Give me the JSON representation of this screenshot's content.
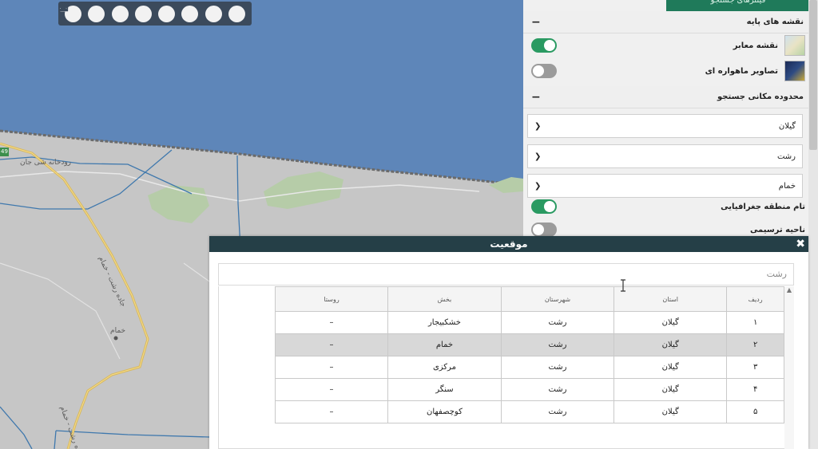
{
  "toolbar": {
    "tools": [
      {
        "name": "print-icon"
      },
      {
        "name": "zoom-in-icon"
      },
      {
        "name": "zoom-out-icon"
      },
      {
        "name": "measure-line-icon"
      },
      {
        "name": "measure-area-icon"
      },
      {
        "name": "info-icon"
      },
      {
        "name": "full-extent-icon"
      },
      {
        "name": "clear-brush-icon"
      }
    ]
  },
  "map": {
    "labels": {
      "river": "رودخانه شی جان",
      "village": "خمام",
      "road1": "جاده رشت - خمام",
      "road2": "جاده رشت - خمام"
    },
    "road_badge": "49",
    "colors": {
      "sea": "#5e86b9",
      "land": "#c6c6c6",
      "green": "#b6cca8",
      "road": "#d9b85b",
      "river": "#3f78ad"
    }
  },
  "panel": {
    "top_tab": "فیلترهای جستجو",
    "base_maps": {
      "title": "نقشه های پایه",
      "collapse": "−",
      "layers": [
        {
          "label": "نقشه معابر",
          "on": true
        },
        {
          "label": "تصاویر ماهواره ای",
          "on": false
        }
      ]
    },
    "search_area": {
      "title": "محدوده مکانی جستجو",
      "collapse": "−",
      "province": "گیلان",
      "county": "رشت",
      "district": "خمام",
      "options": [
        {
          "label": "تام منطقه جغرافیایی",
          "on": true
        },
        {
          "label": "ناحیه ترسیمی",
          "on": false
        }
      ]
    }
  },
  "dialog": {
    "title": "موقعیت",
    "close": "✖",
    "filter_value": "رشت",
    "columns": [
      "ردیف",
      "استان",
      "شهرستان",
      "بخش",
      "روستا"
    ],
    "rows": [
      [
        "۱",
        "گیلان",
        "رشت",
        "خشکبیجار",
        "–"
      ],
      [
        "۲",
        "گیلان",
        "رشت",
        "خمام",
        "–"
      ],
      [
        "۳",
        "گیلان",
        "رشت",
        "مرکزی",
        "–"
      ],
      [
        "۴",
        "گیلان",
        "رشت",
        "سنگر",
        "–"
      ],
      [
        "۵",
        "گیلان",
        "رشت",
        "کوچصفهان",
        "–"
      ]
    ],
    "selected_row": 1,
    "scroll_up": "▲"
  }
}
